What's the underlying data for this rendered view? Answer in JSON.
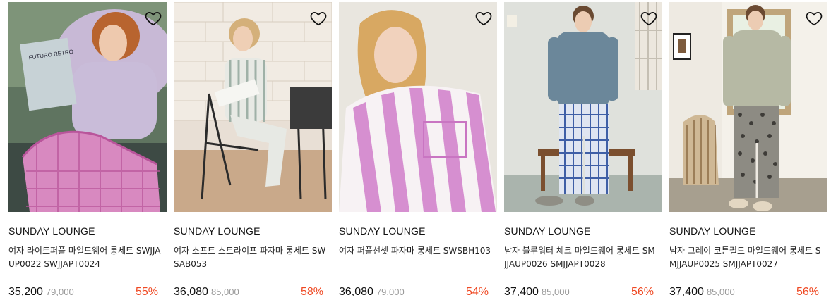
{
  "products": [
    {
      "brand": "SUNDAY LOUNGE",
      "name": "여자 라이트퍼플 마일드웨어 롱세트 SWJJAUP0022 SWJJAPT0024",
      "price": "35,200",
      "original_price": "79,000",
      "discount": "55%",
      "wishlist_icon": "heart-outline-icon"
    },
    {
      "brand": "SUNDAY LOUNGE",
      "name": "여자 소프트 스트라이프 파자마 롱세트 SWSAB053",
      "price": "36,080",
      "original_price": "85,000",
      "discount": "58%",
      "wishlist_icon": "heart-outline-icon"
    },
    {
      "brand": "SUNDAY LOUNGE",
      "name": "여자 퍼플선셋 파자마 롱세트 SWSBH103",
      "price": "36,080",
      "original_price": "79,000",
      "discount": "54%",
      "wishlist_icon": "heart-outline-icon"
    },
    {
      "brand": "SUNDAY LOUNGE",
      "name": "남자 블루워터 체크 마일드웨어 롱세트 SMJJAUP0026 SMJJAPT0028",
      "price": "37,400",
      "original_price": "85,000",
      "discount": "56%",
      "wishlist_icon": "heart-outline-icon"
    },
    {
      "brand": "SUNDAY LOUNGE",
      "name": "남자 그레이 코튼필드 마일드웨어 롱세트 SMJJAUP0025 SMJJAPT0027",
      "price": "37,400",
      "original_price": "85,000",
      "discount": "56%",
      "wishlist_icon": "heart-outline-icon"
    }
  ],
  "colors": {
    "discount": "#ef4a24",
    "original_price": "#9a9a9a",
    "brand": "#111111"
  }
}
